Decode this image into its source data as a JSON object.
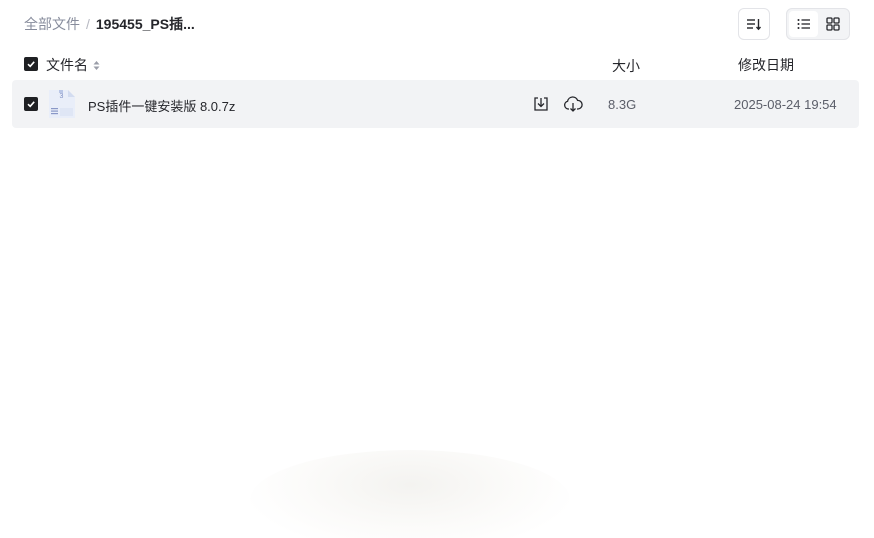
{
  "breadcrumb": {
    "root": "全部文件",
    "separator": "/",
    "current": "195455_PS插..."
  },
  "toolbar": {
    "sort_icon": "sort-list-icon",
    "views": [
      {
        "icon": "list-view-icon",
        "active": true
      },
      {
        "icon": "grid-view-icon",
        "active": false
      }
    ]
  },
  "table": {
    "headers": {
      "name": "文件名",
      "size": "大小",
      "date": "修改日期"
    },
    "select_all_checked": true,
    "rows": [
      {
        "checked": true,
        "icon": "archive-file-icon",
        "name": "PS插件一键安装版 8.0.7z",
        "actions": [
          "download-icon",
          "cloud-save-icon"
        ],
        "size": "8.3G",
        "modified": "2025-08-24 19:54"
      }
    ]
  },
  "colors": {
    "text": "#25262b",
    "muted": "#878c9c",
    "row_bg": "#f2f3f5",
    "checkbox": "#1f2023"
  }
}
